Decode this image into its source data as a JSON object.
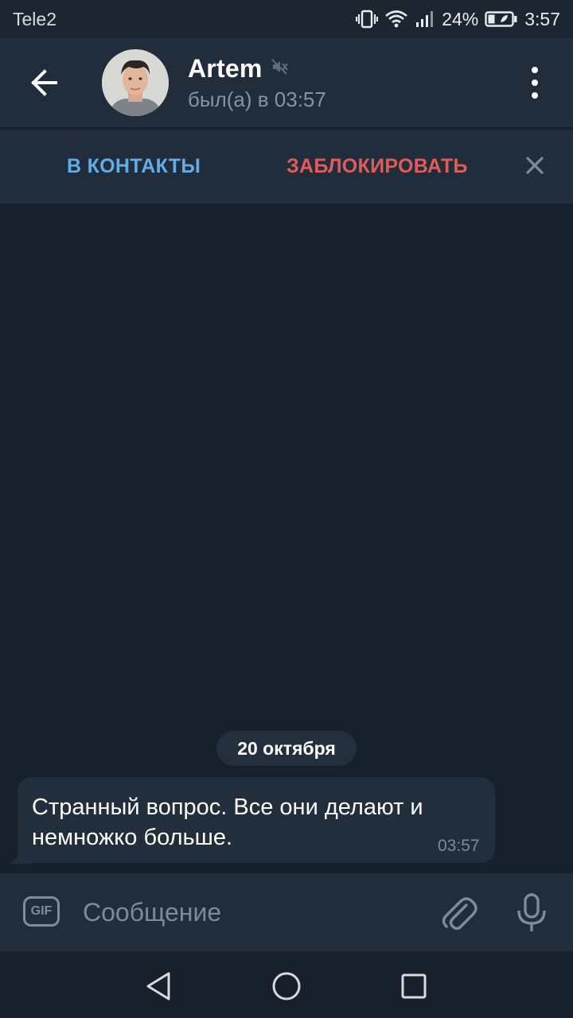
{
  "status_bar": {
    "carrier": "Tele2",
    "battery": "24%",
    "time": "3:57"
  },
  "header": {
    "name": "Artem",
    "last_seen": "был(а) в 03:57"
  },
  "actions": {
    "add_contact": "В КОНТАКТЫ",
    "block": "ЗАБЛОКИРОВАТЬ"
  },
  "chat": {
    "date": "20 октября",
    "messages": [
      {
        "text": "Странный вопрос.  Все они делают и немножко больше.",
        "time": "03:57"
      }
    ]
  },
  "composer": {
    "gif_label": "GIF",
    "placeholder": "Сообщение"
  },
  "colors": {
    "background": "#18202b",
    "header": "#212d3b",
    "accent_blue": "#62ace8",
    "danger_red": "#e05c5c",
    "bubble": "#222e3b"
  }
}
